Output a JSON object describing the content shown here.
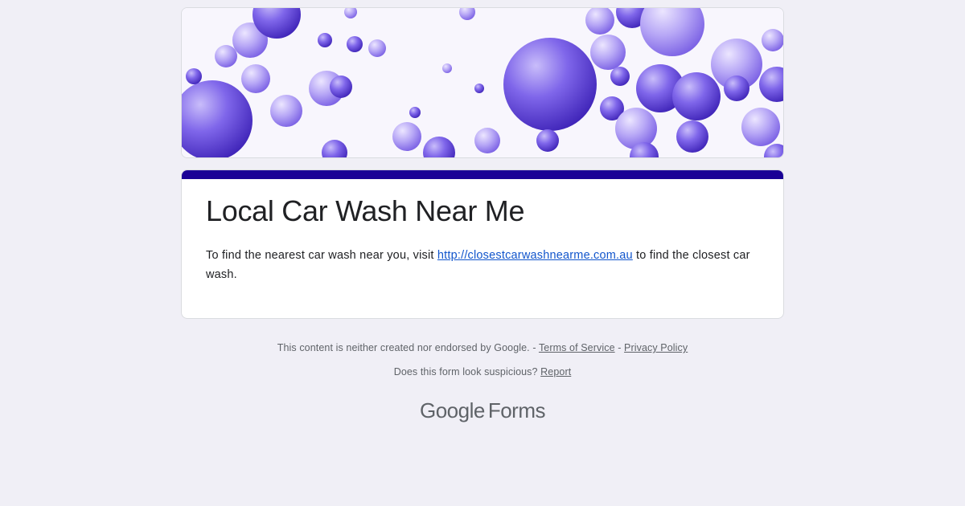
{
  "form": {
    "title": "Local Car Wash Near Me",
    "description_before": "To find the nearest car wash near you, visit ",
    "description_link": "http://closestcarwashnearme.com.au",
    "description_after": " to find the closest car wash.",
    "accent_color": "#1a0096"
  },
  "footer": {
    "disclaimer": "This content is neither created nor endorsed by Google. - ",
    "terms": "Terms of Service",
    "separator": " - ",
    "privacy": "Privacy Policy",
    "suspicious_question": "Does this form look suspicious? ",
    "report": "Report"
  },
  "brand": {
    "google": "Google",
    "forms": "Forms"
  },
  "header_image": {
    "icon": "purple-bubbles-banner",
    "colors": [
      "#6a4fe0",
      "#8c76ee",
      "#b9aaf6"
    ]
  }
}
